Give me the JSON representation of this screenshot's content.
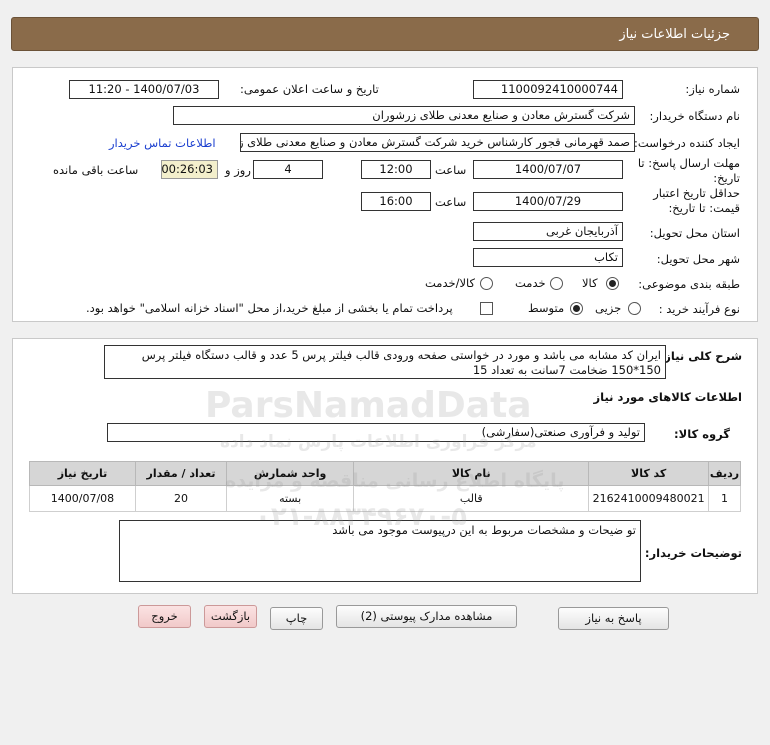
{
  "header": {
    "title": "جزئیات اطلاعات نیاز"
  },
  "form": {
    "need_number_label": "شماره نیاز:",
    "need_number": "1100092410000744",
    "announce_label": "تاریخ و ساعت اعلان عمومی:",
    "announce_value": "1400/07/03 - 11:20",
    "buyer_label": "نام دستگاه خریدار:",
    "buyer_value": "شرکت گسترش معادن و صنایع معدنی طلای زرشوران",
    "creator_label": "ایجاد کننده درخواست:",
    "creator_value": "صمد قهرمانی قجور کارشناس خرید شرکت گسترش معادن و صنایع معدنی طلای زرشوران",
    "contact_link": "اطلاعات تماس خریدار",
    "deadline_label_1": "مهلت ارسال پاسخ: تا",
    "deadline_label_2": "تاریخ:",
    "deadline_date": "1400/07/07",
    "time_label": "ساعت",
    "deadline_time": "12:00",
    "days_value": "4",
    "days_label": "روز و",
    "remaining_value": "00:26:03",
    "remaining_label": "ساعت باقی مانده",
    "validity_label_1": "حداقل تاریخ اعتبار",
    "validity_label_2": "قیمت: تا تاریخ:",
    "validity_date": "1400/07/29",
    "validity_time_label": "ساعت",
    "validity_time": "16:00",
    "province_label": "استان محل تحویل:",
    "province_value": "آذربایجان غربی",
    "city_label": "شهر محل تحویل:",
    "city_value": "تکاب",
    "category_label": "طبقه بندی موضوعی:",
    "category_options": [
      "کالا",
      "خدمت",
      "کالا/خدمت"
    ],
    "category_selected": "کالا",
    "process_label": "نوع فرآیند خرید :",
    "process_options": [
      "جزیی",
      "متوسط"
    ],
    "process_selected": "متوسط",
    "treasury_note": "پرداخت تمام یا بخشی از مبلغ خرید،از محل \"اسناد خزانه اسلامی\" خواهد بود."
  },
  "description": {
    "label": "شرح کلی نیاز:",
    "text": "ایران کد مشابه می باشد و مورد در خواستی صفحه ورودی قالب فیلتر پرس 5 عدد و قالب دستگاه فیلتر پرس 150*150 ضخامت 7سانت به تعداد 15"
  },
  "goods": {
    "section_title": "اطلاعات کالاهای مورد نیاز",
    "group_label": "گروه کالا:",
    "group_value": "تولید و فرآوری صنعتی(سفارشی)",
    "columns": [
      "ردیف",
      "کد کالا",
      "نام کالا",
      "واحد شمارش",
      "تعداد / مقدار",
      "تاریخ نیاز"
    ],
    "rows": [
      [
        "1",
        "2162410009480021",
        "قالب",
        "بسته",
        "20",
        "1400/07/08"
      ]
    ]
  },
  "buyer_notes": {
    "label": "توضیحات خریدار:",
    "text": "تو ضیحات و مشخصات مربوط به این درپیوست موجود می باشد"
  },
  "buttons": {
    "reply": "پاسخ به نیاز",
    "attachments": "مشاهده مدارک پیوستی (2)",
    "print": "چاپ",
    "back": "بازگشت",
    "exit": "خروج"
  },
  "watermark": {
    "brand": "ParsNamadData",
    "line1": "مرکز فراوری اطلاعات پارس نماد داده",
    "line2": "پایگاه اطلاع رسانی مناقصه و مزایده",
    "phone": "۰۲۱-۸۸۳۴۹۶۷۰-۵"
  },
  "colors": {
    "header_bg": "#8a6b4a",
    "link": "#1a3ecf",
    "highlight": "#f3efcc"
  }
}
